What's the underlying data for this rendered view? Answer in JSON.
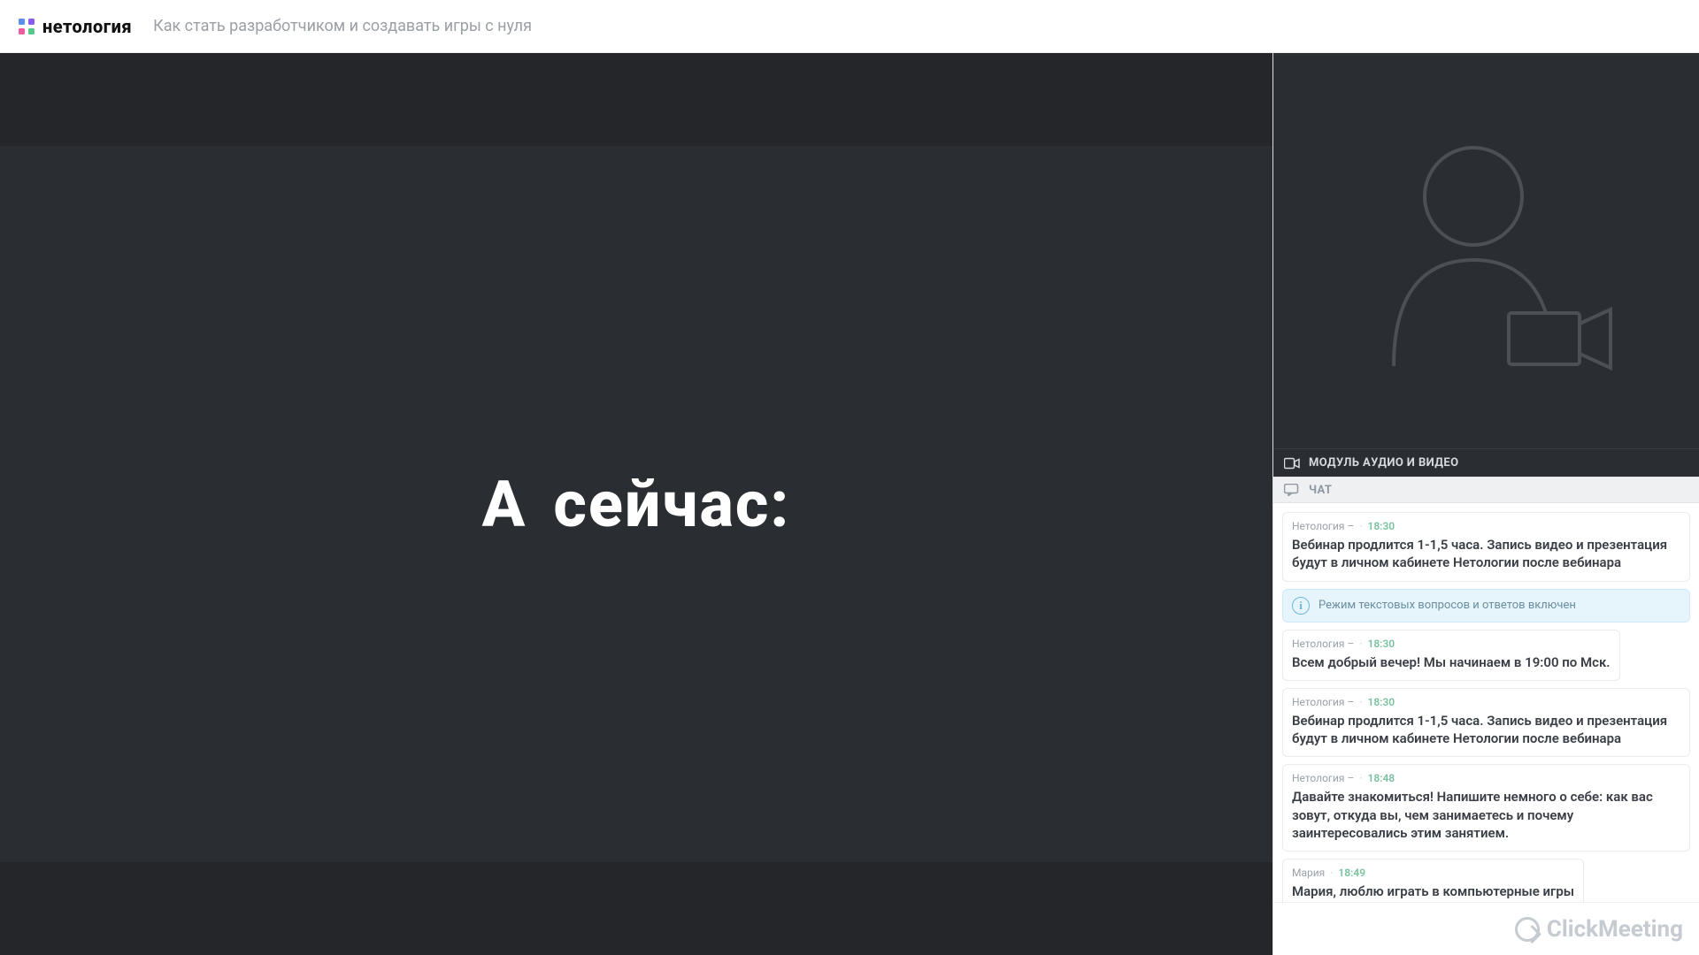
{
  "header": {
    "brand": "нетология",
    "title": "Как стать разработчиком и создавать игры с нуля"
  },
  "slide": {
    "text_a": "А",
    "text_b": "сейчас:"
  },
  "sidebar": {
    "av_label": "МОДУЛЬ АУДИО И ВИДЕО",
    "chat_label": "ЧАТ",
    "notice": "Режим текстовых вопросов и ответов включен",
    "footer_brand": "ClickMeeting"
  },
  "messages": [
    {
      "author": "Нетология –",
      "time": "18:30",
      "text": "Вебинар продлится 1-1,5 часа. Запись видео и презентация будут в личном кабинете Нетологии после вебинара",
      "full": true
    },
    {
      "author": "Нетология –",
      "time": "18:30",
      "text": "Всем добрый вечер! Мы начинаем в 19:00 по Мск.",
      "full": false
    },
    {
      "author": "Нетология –",
      "time": "18:30",
      "text": "Вебинар продлится 1-1,5 часа. Запись видео и презентация будут в личном кабинете Нетологии после вебинара",
      "full": true
    },
    {
      "author": "Нетология –",
      "time": "18:48",
      "text": "Давайте знакомиться! Напишите немного о себе: как вас зовут, откуда вы, чем занимаетесь и почему заинтересовались этим занятием.",
      "full": true
    },
    {
      "author": "Мария",
      "time": "18:49",
      "text": "Мария, люблю играть в компьютерные игры",
      "full": false
    }
  ]
}
